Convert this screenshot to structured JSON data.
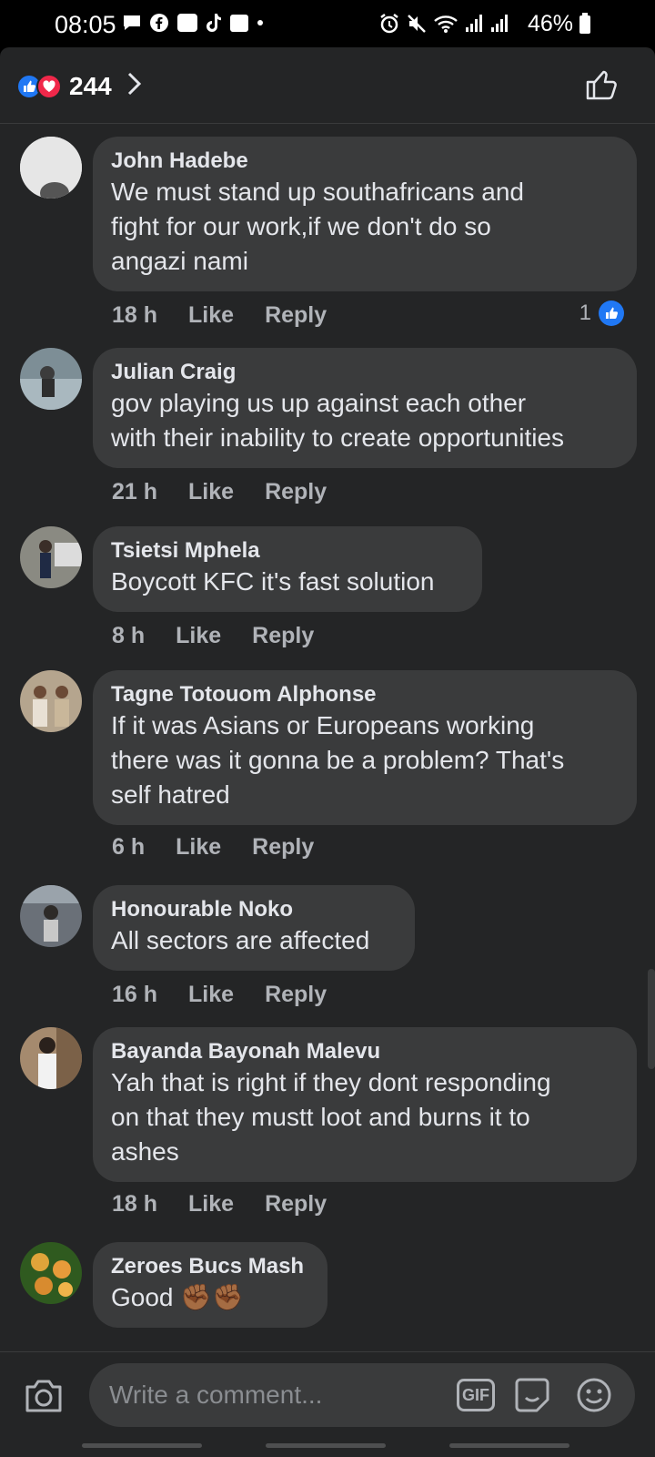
{
  "status_bar": {
    "time": "08:05",
    "left_icons": [
      "message-icon",
      "facebook-icon",
      "ai-icon",
      "tiktok-icon",
      "calendar-icon"
    ],
    "calendar_day": "26",
    "ai_label": "Ai",
    "right_icons": [
      "alarm-icon",
      "mute-icon",
      "wifi-icon",
      "signal-icon",
      "signal-icon",
      "battery-icon"
    ],
    "battery": "46%"
  },
  "header": {
    "reaction_count": "244"
  },
  "comments": [
    {
      "author": "John Hadebe",
      "lines": [
        "We must stand up southafricans and",
        "fight for our work,if we don't do so",
        "angazi nami"
      ],
      "time": "18 h",
      "like": "Like",
      "reply": "Reply",
      "reactions": "1"
    },
    {
      "author": "Julian Craig",
      "lines": [
        "gov playing us up against each  other",
        "with their inability to create opportunities"
      ],
      "time": "21 h",
      "like": "Like",
      "reply": "Reply"
    },
    {
      "author": "Tsietsi Mphela",
      "lines": [
        "Boycott KFC it's fast solution"
      ],
      "time": "8 h",
      "like": "Like",
      "reply": "Reply"
    },
    {
      "author": "Tagne Totouom Alphonse",
      "lines": [
        "If it was Asians or Europeans working",
        "there was it gonna be a problem? That's",
        "self hatred"
      ],
      "time": "6 h",
      "like": "Like",
      "reply": "Reply"
    },
    {
      "author": "Honourable Noko",
      "lines": [
        "All sectors are affected"
      ],
      "time": "16 h",
      "like": "Like",
      "reply": "Reply"
    },
    {
      "author": "Bayanda Bayonah Malevu",
      "lines": [
        "Yah that is right if they dont responding",
        "on that they mustt loot and burns it to",
        "ashes"
      ],
      "time": "18 h",
      "like": "Like",
      "reply": "Reply"
    },
    {
      "author": "Zeroes Bucs Mash",
      "lines": [
        "Good"
      ],
      "emoji": "✊🏾✊🏾"
    }
  ],
  "composer": {
    "placeholder": "Write a comment...",
    "gif_label": "GIF"
  },
  "colors": {
    "background": "#242526",
    "bubble": "#3a3b3c",
    "like_blue": "#2078f4",
    "love_red": "#f0284a"
  }
}
